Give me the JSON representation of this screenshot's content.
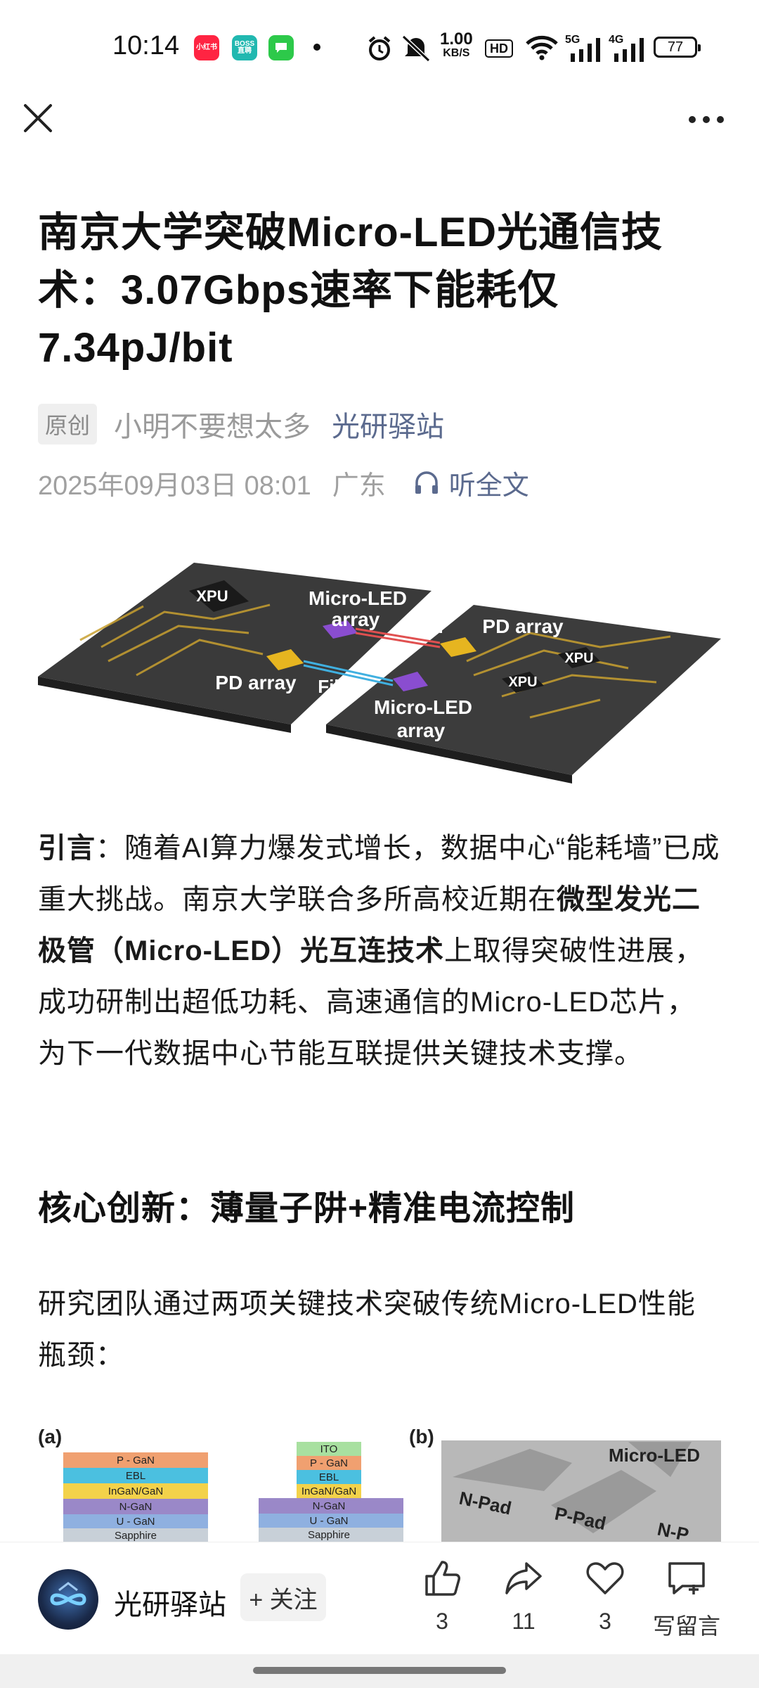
{
  "status_bar": {
    "time": "10:14",
    "apps": [
      {
        "label": "小红书",
        "color": "#ff2442"
      },
      {
        "label": "BOSS直聘",
        "color": "#21b8b0"
      },
      {
        "label": "",
        "color": "#2dc94a"
      }
    ],
    "speed_value": "1.00",
    "speed_unit": "KB/S",
    "hd_badge": "HD",
    "network_5g": "5G",
    "network_4g": "4G",
    "battery": "77"
  },
  "article": {
    "title": "南京大学突破Micro-LED光通信技术：3.07Gbps速率下能耗仅7.34pJ/bit",
    "original_tag": "原创",
    "author": "小明不要想太多",
    "account": "光研驿站",
    "date": "2025年09月03日 08:01",
    "location": "广东",
    "listen_label": "听全文",
    "hero_labels": {
      "xpu": "XPU",
      "micro_led": "Micro-LED",
      "array": "array",
      "fiber": "Fiber",
      "pd_array": "PD array"
    },
    "intro": {
      "lead": "引言",
      "part1": "：随着AI算力爆发式增长，数据中心“能耗墙”已成重大挑战。南京大学联合多所高校近期在",
      "bold": "微型发光二极管（Micro-LED）光互连技术",
      "part2": "上取得突破性进展，成功研制出超低功耗、高速通信的Micro-LED芯片，为下一代数据中心节能互联提供关键技术支撑。"
    },
    "heading": "核心创新：薄量子阱+精准电流控制",
    "para2": "研究团队通过两项关键技术突破传统Micro-LED性能瓶颈：",
    "figure2": {
      "label_a": "(a)",
      "label_b": "(b)",
      "stack_left": [
        "P - GaN",
        "EBL",
        "InGaN/GaN",
        "N-GaN",
        "U - GaN",
        "Sapphire"
      ],
      "stack_right": [
        "ITO",
        "P - GaN",
        "EBL",
        "InGaN/GaN",
        "N-GaN",
        "U - GaN",
        "Sapphire"
      ],
      "micro_led": "Micro-LED",
      "n_pad": "N-Pad",
      "p_pad": "P-Pad",
      "n_pad_cut": "N-P"
    }
  },
  "bottom_bar": {
    "account_name": "光研驿站",
    "follow_label": "+ 关注",
    "like_count": "3",
    "share_count": "11",
    "favorite_count": "3",
    "comment_label": "写留言"
  },
  "colors": {
    "accent_link": "#5b6a8e",
    "meta_gray": "#a0a0a0"
  }
}
